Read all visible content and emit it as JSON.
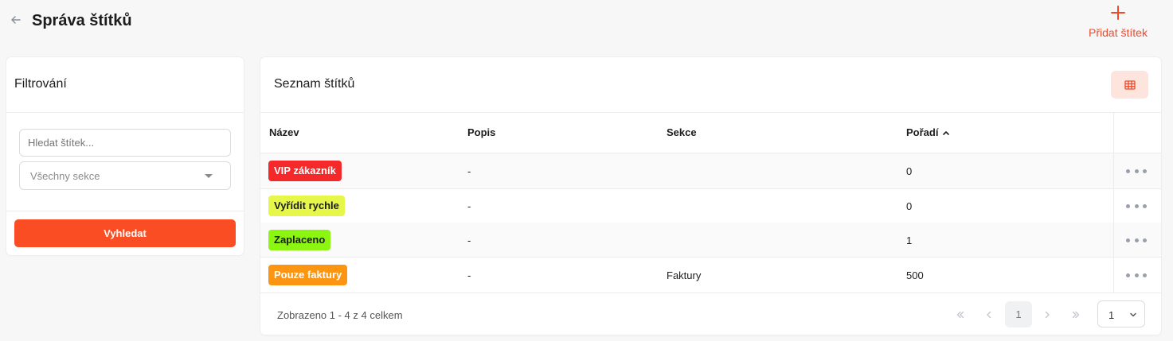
{
  "header": {
    "title": "Správa štítků",
    "add_label": "Přidat štítek"
  },
  "filter": {
    "title": "Filtrování",
    "search_placeholder": "Hledat štítek...",
    "section_select": "Všechny sekce",
    "search_button": "Vyhledat"
  },
  "list": {
    "title": "Seznam štítků",
    "columns": [
      "Název",
      "Popis",
      "Sekce",
      "Pořadí"
    ],
    "rows": [
      {
        "name": "VIP zákazník",
        "description": "-",
        "section": "",
        "order": "0"
      },
      {
        "name": "Vyřídit rychle",
        "description": "-",
        "section": "",
        "order": "0"
      },
      {
        "name": "Zaplaceno",
        "description": "-",
        "section": "",
        "order": "1"
      },
      {
        "name": "Pouze faktury",
        "description": "-",
        "section": "Faktury",
        "order": "500"
      }
    ],
    "footer": "Zobrazeno 1 - 4 z 4 celkem",
    "pagination": {
      "current_page": "1",
      "page_size": "1"
    }
  },
  "colors": {
    "accent": "#fb4d24",
    "tag_vip": "#f5282a",
    "tag_rychle": "#e6f74a",
    "tag_zaplaceno": "#8cf512",
    "tag_faktury": "#fc9512"
  },
  "icons": {
    "back": "arrow-left-icon",
    "add": "plus-icon",
    "view": "table-icon",
    "sort": "chevron-up-icon",
    "row_actions": "more-horizontal-icon"
  }
}
